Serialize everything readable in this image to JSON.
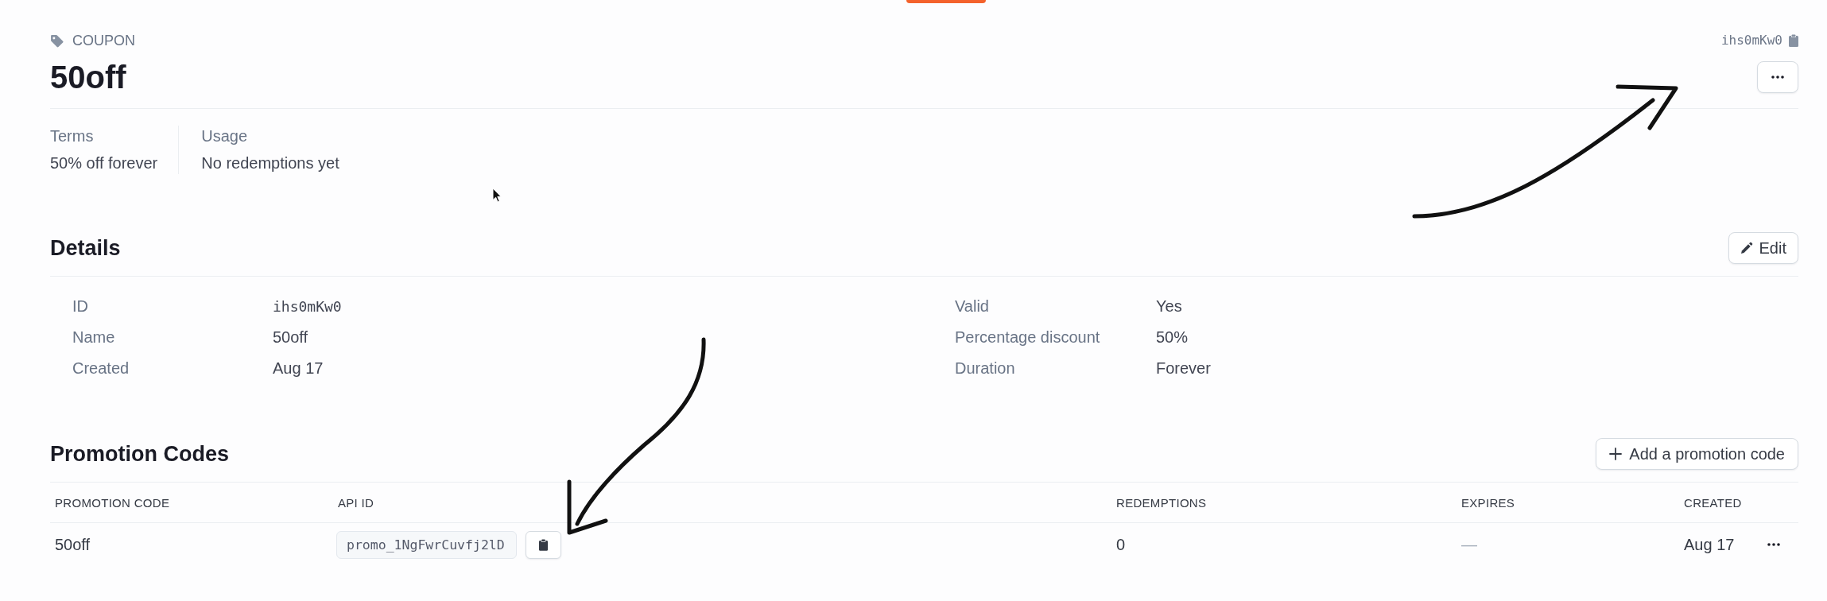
{
  "header": {
    "type_label": "COUPON",
    "title": "50off",
    "object_id": "ihs0mKw0"
  },
  "summary": [
    {
      "label": "Terms",
      "value": "50% off forever"
    },
    {
      "label": "Usage",
      "value": "No redemptions yet"
    }
  ],
  "details": {
    "title": "Details",
    "edit_button": "Edit",
    "field_columns": [
      [
        {
          "label": "ID",
          "value": "ihs0mKw0",
          "kind": "code"
        },
        {
          "label": "Name",
          "value": "50off",
          "kind": "text"
        },
        {
          "label": "Created",
          "value": "Aug 17",
          "kind": "text"
        }
      ],
      [
        {
          "label": "Valid",
          "value": "Yes",
          "kind": "text"
        },
        {
          "label": "Percentage discount",
          "value": "50%",
          "kind": "text"
        },
        {
          "label": "Duration",
          "value": "Forever",
          "kind": "text"
        }
      ]
    ]
  },
  "promotion_codes": {
    "title": "Promotion Codes",
    "add_button": "Add a promotion code",
    "columns": [
      "PROMOTION CODE",
      "API ID",
      "REDEMPTIONS",
      "EXPIRES",
      "CREATED"
    ],
    "rows": [
      {
        "code": "50off",
        "api_id": "promo_1NgFwrCuvfj2lD",
        "redemptions": "0",
        "expires": "—",
        "created": "Aug 17"
      }
    ]
  }
}
